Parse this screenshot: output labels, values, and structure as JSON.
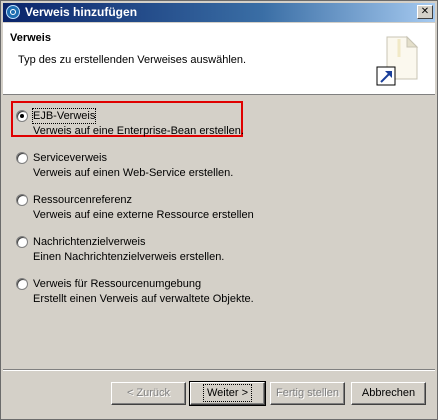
{
  "window": {
    "title": "Verweis hinzufügen",
    "close_glyph": "✕"
  },
  "header": {
    "title": "Verweis",
    "description": "Typ des zu erstellenden Verweises auswählen.",
    "graphic_icon": "new-reference-wizard-icon"
  },
  "options": [
    {
      "label": "EJB-Verweis",
      "description": "Verweis auf eine Enterprise-Bean erstellen.",
      "selected": true
    },
    {
      "label": "Serviceverweis",
      "description": "Verweis auf einen Web-Service erstellen.",
      "selected": false
    },
    {
      "label": "Ressourcenreferenz",
      "description": "Verweis auf eine externe Ressource erstellen",
      "selected": false
    },
    {
      "label": "Nachrichtenzielverweis",
      "description": "Einen Nachrichtenzielverweis erstellen.",
      "selected": false
    },
    {
      "label": "Verweis für Ressourcenumgebung",
      "description": "Erstellt einen Verweis auf verwaltete Objekte.",
      "selected": false
    }
  ],
  "buttons": {
    "back": "< Zurück",
    "next": "Weiter >",
    "finish": "Fertig stellen",
    "cancel": "Abbrechen"
  },
  "colors": {
    "highlight": "#e00000",
    "titlebar_start": "#0a246a",
    "titlebar_end": "#a6caf0",
    "dialog_bg": "#d4d0c8"
  }
}
